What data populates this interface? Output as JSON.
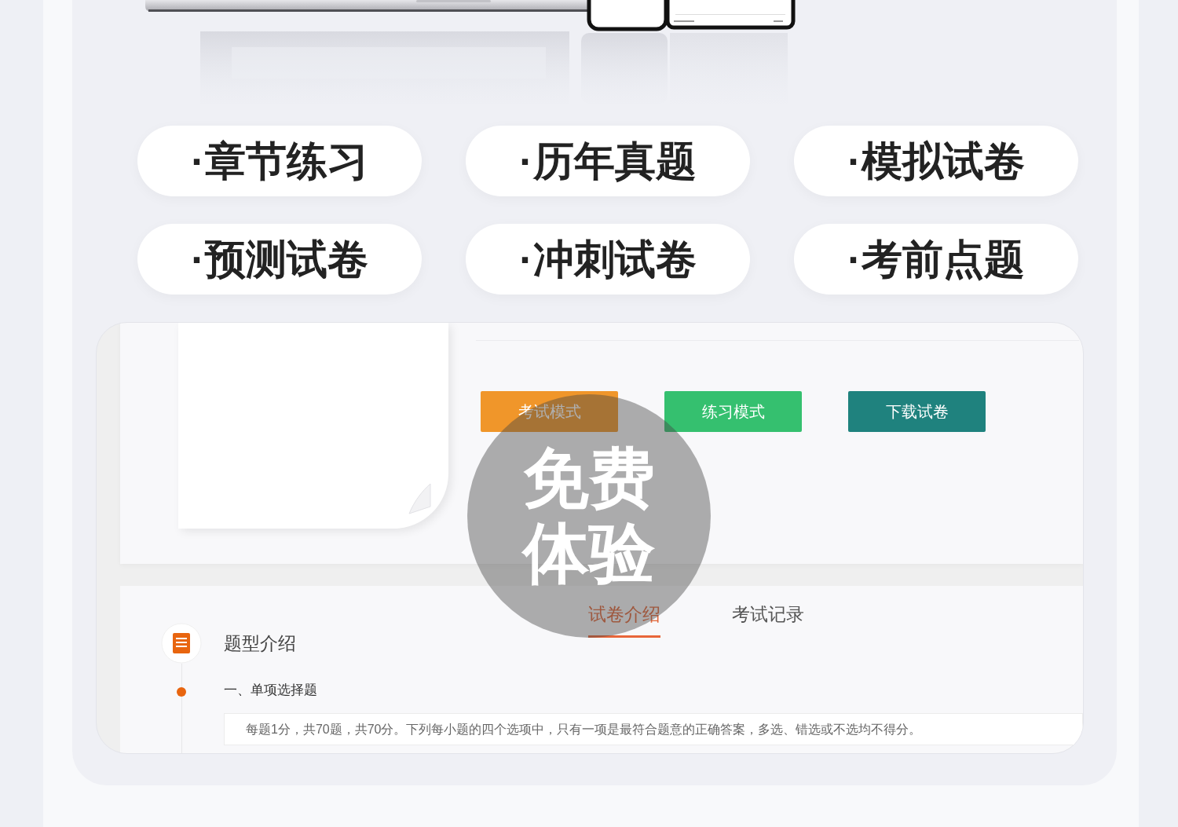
{
  "features": [
    {
      "label": "·章节练习"
    },
    {
      "label": "·历年真题"
    },
    {
      "label": "·模拟试卷"
    },
    {
      "label": "·预测试卷"
    },
    {
      "label": "·冲刺试卷"
    },
    {
      "label": "·考前点题"
    }
  ],
  "preview": {
    "buttons": [
      {
        "label": "考试模式",
        "color": "#f0962a"
      },
      {
        "label": "练习模式",
        "color": "#35c06f"
      },
      {
        "label": "下载试卷",
        "color": "#1f827e"
      }
    ],
    "tabs": [
      {
        "label": "试卷介绍",
        "selected": true
      },
      {
        "label": "考试记录",
        "selected": false
      }
    ],
    "section": {
      "heading": "题型介绍",
      "items": [
        {
          "title": "一、单项选择题",
          "description": "每题1分，共70题，共70分。下列每小题的四个选项中，只有一项是最符合题意的正确答案，多选、错选或不选均不得分。"
        }
      ]
    }
  },
  "badge": {
    "text": "免费体验"
  }
}
